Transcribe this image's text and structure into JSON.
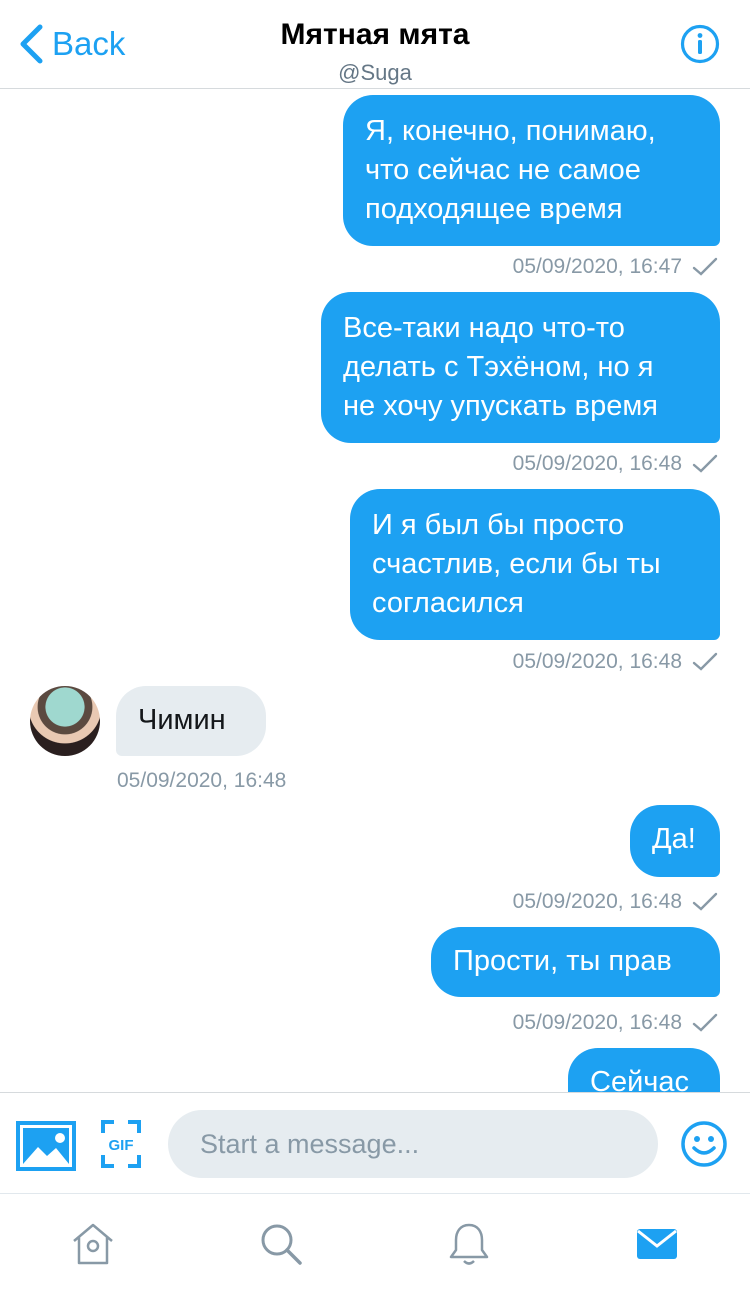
{
  "header": {
    "back_label": "Back",
    "title": "Мятная мята",
    "handle": "@Suga"
  },
  "messages": [
    {
      "direction": "out",
      "lines": [
        "Я, конечно, понимаю,",
        "что сейчас не самое",
        "подходящее время"
      ],
      "timestamp": "05/09/2020, 16:47"
    },
    {
      "direction": "out",
      "lines": [
        "Все-таки надо что-то",
        "делать с Тэхёном, но я",
        "не хочу упускать время"
      ],
      "timestamp": "05/09/2020, 16:48"
    },
    {
      "direction": "out",
      "lines": [
        "И я был бы просто",
        "счастлив, если бы ты",
        "согласился"
      ],
      "timestamp": "05/09/2020, 16:48"
    },
    {
      "direction": "in",
      "lines": [
        "Чимин"
      ],
      "timestamp": "05/09/2020, 16:48"
    },
    {
      "direction": "out",
      "lines": [
        "Да!"
      ],
      "timestamp": "05/09/2020, 16:48"
    },
    {
      "direction": "out",
      "lines": [
        "Прости, ты прав"
      ],
      "timestamp": "05/09/2020, 16:48"
    },
    {
      "direction": "out",
      "lines": [
        "Сейчас"
      ],
      "timestamp": ""
    }
  ],
  "composer": {
    "placeholder": "Start a message...",
    "gif_label": "GIF"
  },
  "colors": {
    "accent": "#1da1f2",
    "incoming_bubble": "#e6ecf0",
    "meta_text": "#8899a6"
  },
  "icons": [
    "chevron-left-icon",
    "info-icon",
    "checkmark-icon",
    "image-icon",
    "gif-icon",
    "emoji-icon",
    "home-icon",
    "search-icon",
    "bell-icon",
    "mail-icon"
  ]
}
